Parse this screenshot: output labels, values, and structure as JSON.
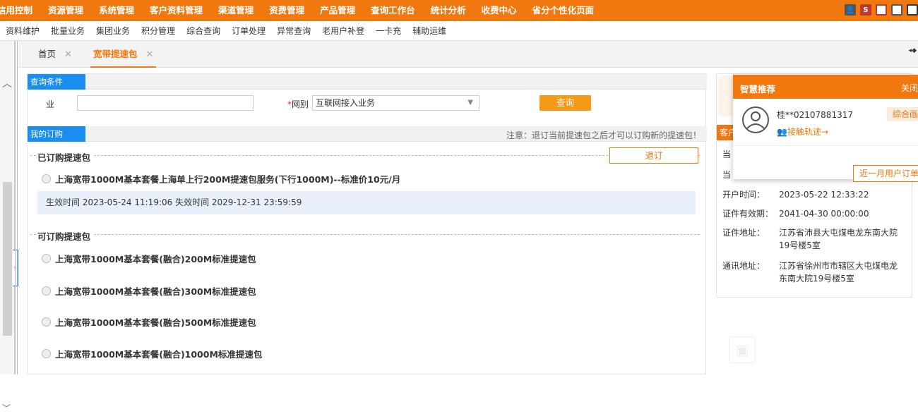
{
  "topnav": [
    "信用控制",
    "资源管理",
    "系统管理",
    "客户资料管理",
    "渠道管理",
    "资费管理",
    "产品管理",
    "查询工作台",
    "统计分析",
    "收费中心",
    "省分个性化页面"
  ],
  "subnav": [
    "资料维护",
    "批量业务",
    "集团业务",
    "积分管理",
    "综合查询",
    "订单处理",
    "异常查询",
    "老用户补登",
    "一卡充",
    "辅助运维"
  ],
  "tabs": {
    "home": "首页",
    "active": "宽带提速包",
    "close": "✕"
  },
  "query": {
    "section_title": "查询条件",
    "biz_label": "业",
    "biz_value": "",
    "net_required": "*",
    "net_label": "网别",
    "net_value": "互联网接入业务",
    "search_button": "查询"
  },
  "my_order": {
    "section_title": "我的订购",
    "note": "注意：退订当前提速包之后才可以订购新的提速包！",
    "subscribed_title": "已订购提速包",
    "unsubscribe_button": "退订",
    "current_package": "上海宽带1000M基本套餐上海单上行200M提速包服务(下行1000M)--标准价10元/月",
    "effective": "生效时间 2023-05-24 11:19:06 失效时间 2029-12-31 23:59:59",
    "available_title": "可订购提速包",
    "available": [
      "上海宽带1000M基本套餐(融合)200M标准提速包",
      "上海宽带1000M基本套餐(融合)300M标准提速包",
      "上海宽带1000M基本套餐(融合)500M标准提速包",
      "上海宽带1000M基本套餐(融合)1000M标准提速包"
    ]
  },
  "customer": {
    "head": "客户",
    "rows": [
      {
        "k": "当",
        "v": ""
      },
      {
        "k": "当",
        "v": ""
      },
      {
        "k": "开户时间：",
        "v": "2023-05-22 12:33:22"
      },
      {
        "k": "证件有效期：",
        "v": "2041-04-30 00:00:00"
      },
      {
        "k": "证件地址：",
        "v": "江苏省沛县大屯煤电龙东南大院19号楼5室"
      },
      {
        "k": "通讯地址：",
        "v": "江苏省徐州市市辖区大屯煤电龙东南大院19号楼5室"
      }
    ]
  },
  "popup": {
    "title": "智慧推荐",
    "close": "关闭",
    "user": "桂**02107881317",
    "tag": "综合画",
    "track": "接触轨迹→",
    "recent_button": "近一月用户订单"
  },
  "colors": {
    "brand": "#f0780e",
    "tag_blue": "#1a8df0",
    "button": "#f59a17"
  }
}
